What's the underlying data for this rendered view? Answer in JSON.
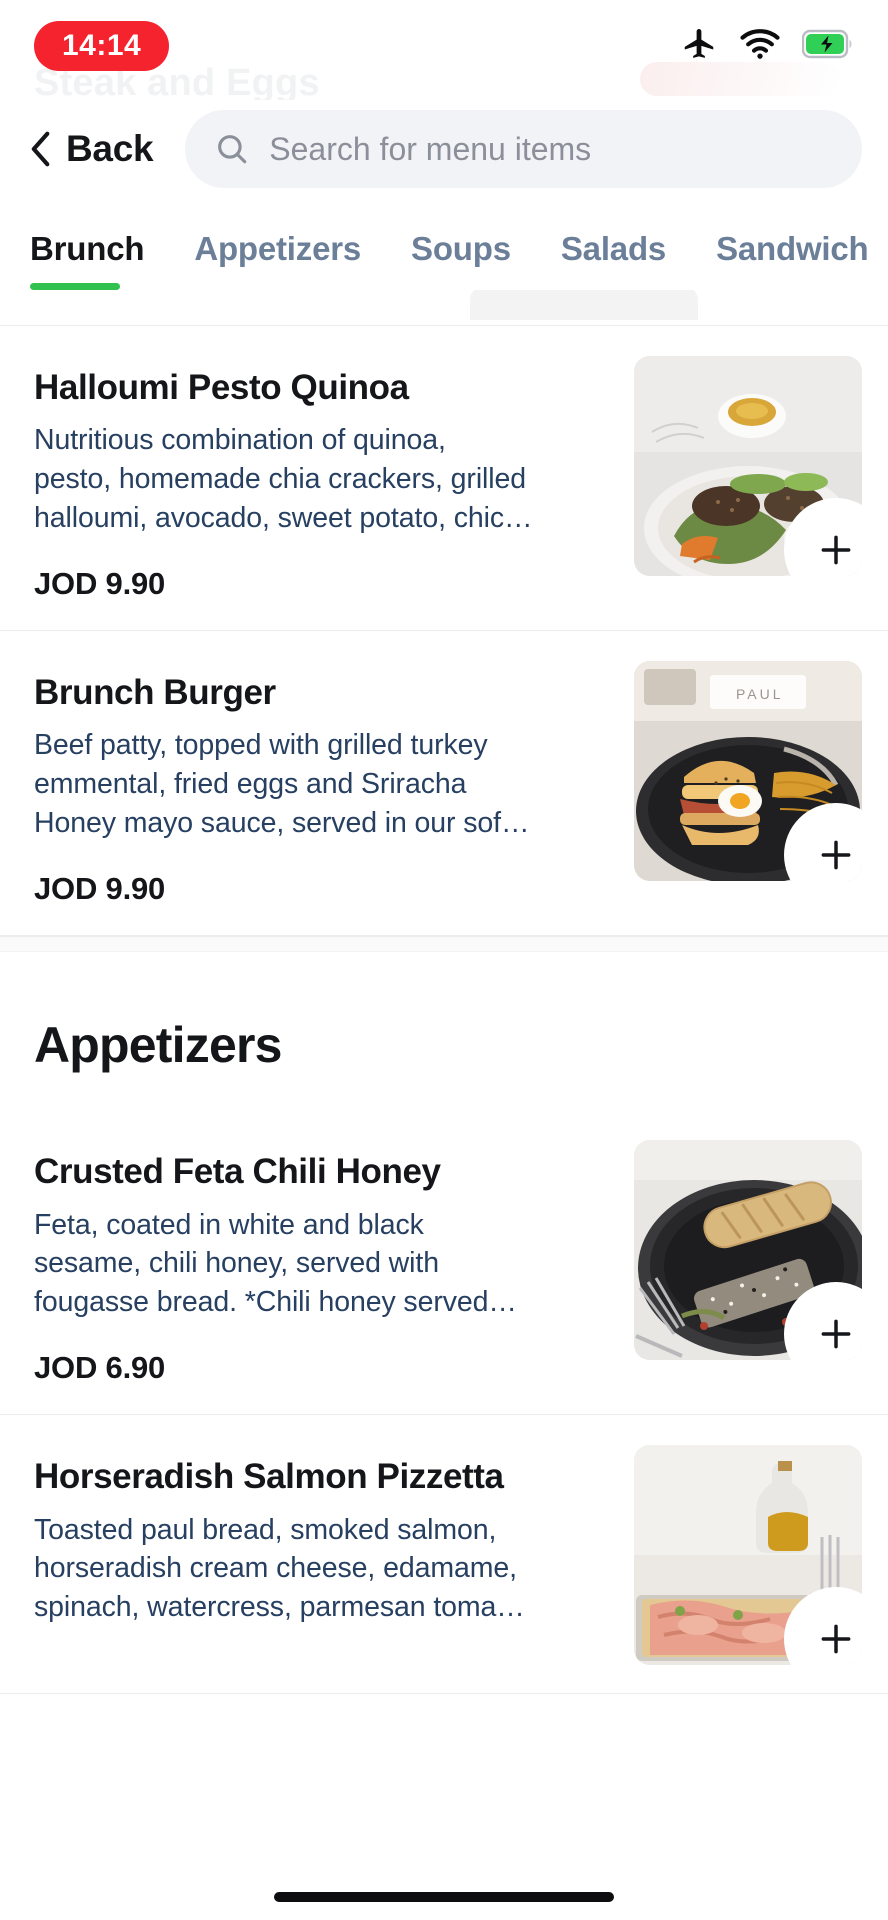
{
  "status_bar": {
    "time": "14:14",
    "time_pill_color": "#f5232d",
    "icons": [
      "airplane-mode-icon",
      "wifi-icon",
      "battery-charging-icon"
    ],
    "battery_color": "#2fd055"
  },
  "ghost_title": "Steak and Eggs",
  "header": {
    "back_label": "Back",
    "back_icon": "chevron-left-icon",
    "search_icon": "search-icon",
    "search_value": "",
    "search_placeholder": "Search for menu items"
  },
  "tabs": {
    "active_index": 0,
    "indicator_color": "#30c14e",
    "items": [
      {
        "label": "Brunch"
      },
      {
        "label": "Appetizers"
      },
      {
        "label": "Soups"
      },
      {
        "label": "Salads"
      },
      {
        "label": "Sandwich"
      }
    ]
  },
  "sections": [
    {
      "heading": null,
      "items": [
        {
          "name": "Halloumi Pesto Quinoa",
          "desc_lines": [
            "Nutritious combination of quinoa,",
            "pesto, homemade chia crackers, grilled",
            "halloumi, avocado, sweet potato, chic…"
          ],
          "price": "JOD 9.90",
          "image": "quinoa-bowl-photo",
          "add_label": "+"
        },
        {
          "name": "Brunch Burger",
          "desc_lines": [
            "Beef patty, topped with grilled turkey",
            "emmental, fried eggs and Sriracha",
            "Honey mayo sauce, served in our sof…"
          ],
          "price": "JOD 9.90",
          "image": "brunch-burger-photo",
          "add_label": "+"
        }
      ]
    },
    {
      "heading": "Appetizers",
      "items": [
        {
          "name": "Crusted Feta Chili Honey",
          "desc_lines": [
            "Feta, coated in white and black",
            "sesame, chili honey, served with",
            "fougasse bread. *Chili honey served…"
          ],
          "price": "JOD 6.90",
          "image": "crusted-feta-photo",
          "add_label": "+"
        },
        {
          "name": "Horseradish Salmon Pizzetta",
          "desc_lines": [
            "Toasted paul bread, smoked salmon,",
            "horseradish cream cheese, edamame,",
            "spinach,  watercress, parmesan toma…"
          ],
          "price": "",
          "image": "salmon-pizzetta-photo",
          "add_label": "+"
        }
      ]
    }
  ],
  "colors": {
    "title": "#15161a",
    "description": "#274061",
    "tab_inactive": "#6b7f99",
    "divider": "#ececef",
    "search_bg": "#f2f3f6"
  }
}
